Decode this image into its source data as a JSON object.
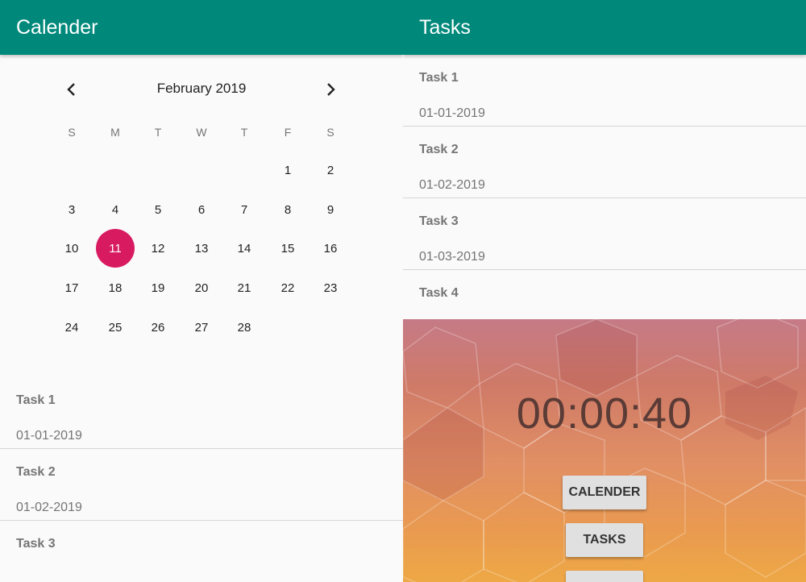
{
  "left": {
    "appbar_title": "Calender",
    "calendar": {
      "month_label": "February 2019",
      "weekdays": [
        "S",
        "M",
        "T",
        "W",
        "T",
        "F",
        "S"
      ],
      "selected_day": "11",
      "weeks": [
        [
          "",
          "",
          "",
          "",
          "",
          "1",
          "2"
        ],
        [
          "3",
          "4",
          "5",
          "6",
          "7",
          "8",
          "9"
        ],
        [
          "10",
          "11",
          "12",
          "13",
          "14",
          "15",
          "16"
        ],
        [
          "17",
          "18",
          "19",
          "20",
          "21",
          "22",
          "23"
        ],
        [
          "24",
          "25",
          "26",
          "27",
          "28",
          "",
          ""
        ]
      ],
      "icons": {
        "prev": "chevron-left-icon",
        "next": "chevron-right-icon"
      }
    },
    "tasks": [
      {
        "title": "Task 1",
        "date": "01-01-2019"
      },
      {
        "title": "Task 2",
        "date": "01-02-2019"
      },
      {
        "title": "Task 3",
        "date": ""
      }
    ]
  },
  "right": {
    "appbar_title": "Tasks",
    "tasks": [
      {
        "title": "Task 1",
        "date": "01-01-2019"
      },
      {
        "title": "Task 2",
        "date": "01-02-2019"
      },
      {
        "title": "Task 3",
        "date": "01-03-2019"
      },
      {
        "title": "Task 4",
        "date": ""
      }
    ],
    "timer": {
      "time": "00:00:40",
      "buttons": {
        "calender": "CALENDER",
        "tasks": "TASKS",
        "third": ""
      }
    }
  },
  "colors": {
    "appbar": "#00897b",
    "selected_day": "#d81b60",
    "background": "#fafafa"
  }
}
